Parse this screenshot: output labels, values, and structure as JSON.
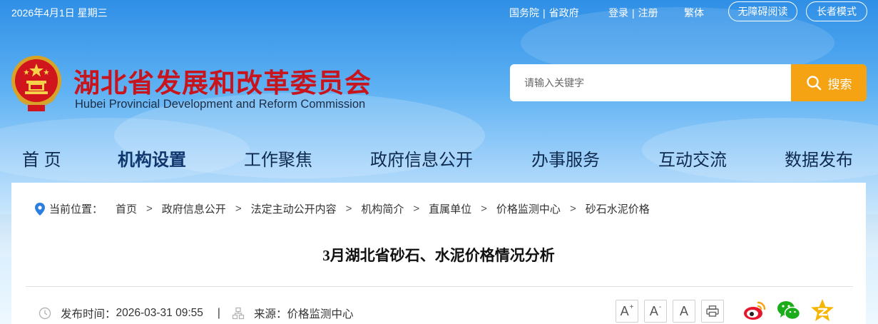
{
  "topbar": {
    "date": "2026年4月1日 星期三",
    "links_group1": [
      "国务院",
      "省政府"
    ],
    "links_group2": [
      "登录",
      "注册"
    ],
    "traditional": "繁体",
    "accessibility": "无障碍阅读",
    "elder_mode": "长者模式"
  },
  "header": {
    "title": "湖北省发展和改革委员会",
    "subtitle": "Hubei Provincial Development and Reform Commission",
    "emblem_icon": "national-emblem-icon"
  },
  "search": {
    "placeholder": "请输入关键字",
    "button_label": "搜索",
    "accent_color": "#f6a313"
  },
  "nav": {
    "items": [
      "首 页",
      "机构设置",
      "工作聚焦",
      "政府信息公开",
      "办事服务",
      "互动交流",
      "数据发布"
    ],
    "active": "机构设置"
  },
  "breadcrumb": {
    "label": "当前位置：",
    "items": [
      "首页",
      "政府信息公开",
      "法定主动公开内容",
      "机构简介",
      "直属单位",
      "价格监测中心",
      "砂石水泥价格"
    ],
    "separator": ">"
  },
  "article": {
    "title": "3月湖北省砂石、水泥价格情况分析",
    "publish_label": "发布时间：",
    "publish_time": "2026-03-31 09:55",
    "source_label": "来源：",
    "source": "价格监测中心",
    "tools": [
      "A+",
      "A-",
      "A",
      "print"
    ],
    "share": [
      "weibo-icon",
      "wechat-icon",
      "qzone-icon"
    ]
  },
  "colors": {
    "title_red": "#c8141d",
    "nav_text": "#0e2a4e",
    "sky_top": "#2f8fe6"
  }
}
